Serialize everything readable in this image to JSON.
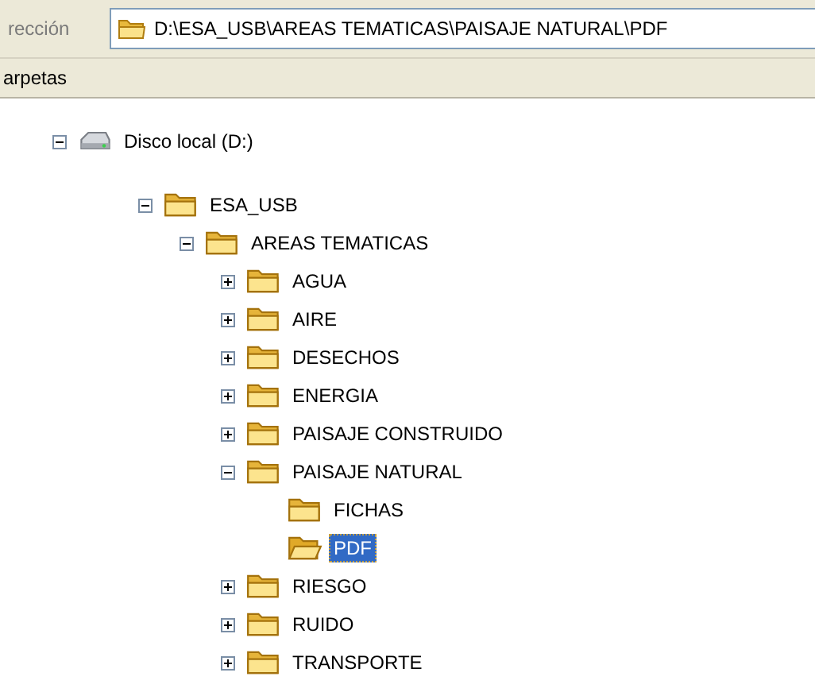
{
  "address_bar": {
    "label": "rección",
    "path": "D:\\ESA_USB\\AREAS TEMATICAS\\PAISAJE NATURAL\\PDF"
  },
  "folders_pane": {
    "title": "arpetas"
  },
  "tree": [
    {
      "kind": "drive",
      "label": "Disco local (D:)",
      "expanded": true,
      "selected": false,
      "children": [
        {
          "kind": "folder",
          "label": "ESA_USB",
          "expanded": true,
          "selected": false,
          "children": [
            {
              "kind": "folder",
              "label": "AREAS TEMATICAS",
              "expanded": true,
              "selected": false,
              "children": [
                {
                  "kind": "folder",
                  "label": "AGUA",
                  "expanded": false,
                  "selected": false
                },
                {
                  "kind": "folder",
                  "label": "AIRE",
                  "expanded": false,
                  "selected": false
                },
                {
                  "kind": "folder",
                  "label": "DESECHOS",
                  "expanded": false,
                  "selected": false
                },
                {
                  "kind": "folder",
                  "label": "ENERGIA",
                  "expanded": false,
                  "selected": false
                },
                {
                  "kind": "folder",
                  "label": "PAISAJE CONSTRUIDO",
                  "expanded": false,
                  "selected": false
                },
                {
                  "kind": "folder",
                  "label": "PAISAJE NATURAL",
                  "expanded": true,
                  "selected": false,
                  "children": [
                    {
                      "kind": "folder",
                      "label": "FICHAS",
                      "selected": false
                    },
                    {
                      "kind": "folder",
                      "label": "PDF",
                      "selected": true
                    }
                  ]
                },
                {
                  "kind": "folder",
                  "label": "RIESGO",
                  "expanded": false,
                  "selected": false
                },
                {
                  "kind": "folder",
                  "label": "RUIDO",
                  "expanded": false,
                  "selected": false
                },
                {
                  "kind": "folder",
                  "label": "TRANSPORTE",
                  "expanded": false,
                  "selected": false
                }
              ]
            }
          ]
        }
      ]
    }
  ]
}
